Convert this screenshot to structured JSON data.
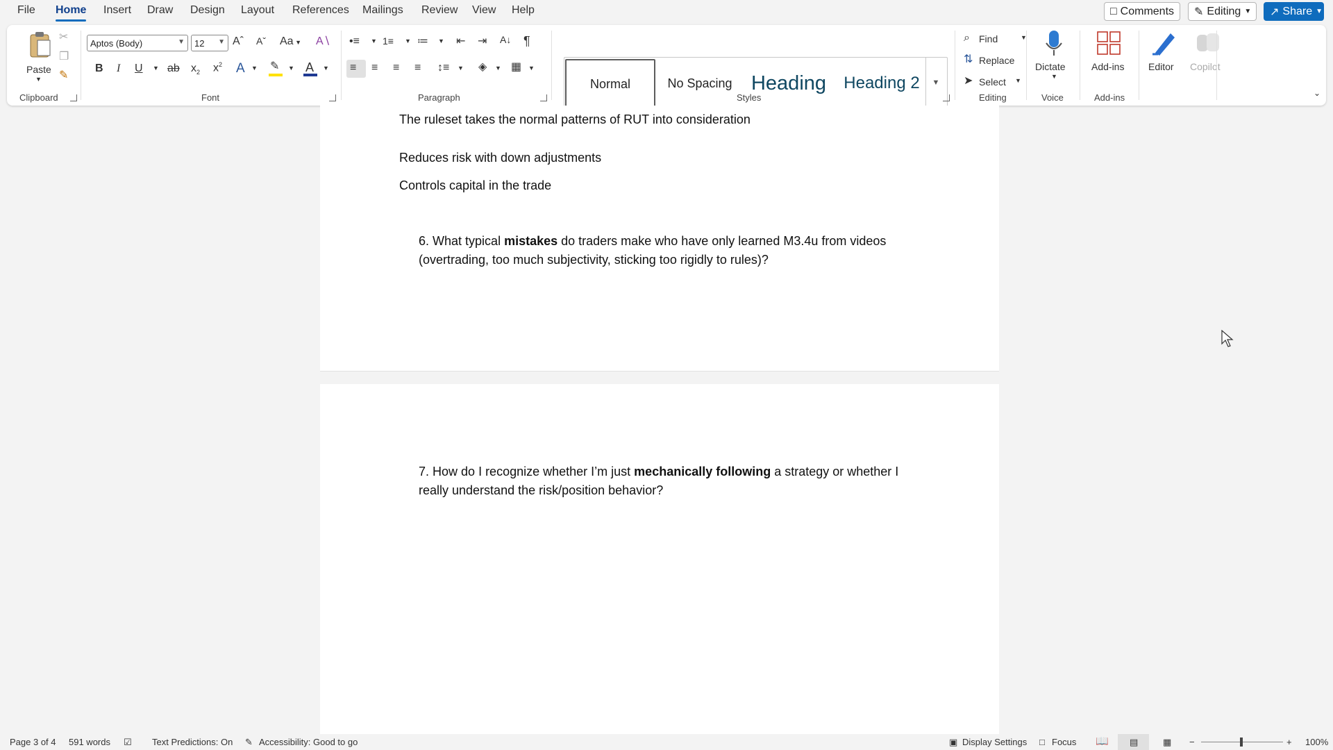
{
  "menu": {
    "tabs": [
      "File",
      "Home",
      "Insert",
      "Draw",
      "Design",
      "Layout",
      "References",
      "Mailings",
      "Review",
      "View",
      "Help"
    ],
    "active": "Home",
    "comments": "Comments",
    "editing": "Editing",
    "share": "Share"
  },
  "clipboard": {
    "paste": "Paste",
    "label": "Clipboard"
  },
  "font": {
    "name": "Aptos (Body)",
    "size": "12",
    "label": "Font",
    "change_case": "Aa"
  },
  "paragraph": {
    "label": "Paragraph"
  },
  "styles": {
    "items": [
      "Normal",
      "No Spacing",
      "Heading 1",
      "Heading 2"
    ],
    "visible_heading1": "Heading",
    "label": "Styles"
  },
  "editing_group": {
    "find": "Find",
    "replace": "Replace",
    "select": "Select",
    "label": "Editing"
  },
  "voice": {
    "dictate": "Dictate",
    "label": "Voice"
  },
  "addins": {
    "addins": "Add-ins",
    "label": "Add-ins"
  },
  "editor": "Editor",
  "copilot": "Copilot",
  "document": {
    "line1": "The ruleset takes the normal patterns of RUT into consideration",
    "line2": "Reduces risk with down adjustments",
    "line3": "Controls capital in the trade",
    "q6": {
      "num": "6.",
      "before": "What typical ",
      "bold": "mistakes",
      "after": " do traders make who have only learned M3.4u from videos",
      "line2": "(overtrading, too much subjectivity, sticking too rigidly to rules)?"
    },
    "q7": {
      "num": "7.",
      "before": "How do I recognize whether I’m just ",
      "bold": "mechanically following",
      "after": " a strategy or whether I",
      "line2": "really understand the risk/position behavior?"
    }
  },
  "status": {
    "page": "Page 3 of 4",
    "words": "591 words",
    "predictions": "Text Predictions: On",
    "accessibility": "Accessibility: Good to go",
    "display": "Display Settings",
    "focus": "Focus",
    "zoom": "100%"
  },
  "colors": {
    "accent": "#0f6cbd",
    "highlight": "#ffe100",
    "font_color": "#1f3a93"
  }
}
